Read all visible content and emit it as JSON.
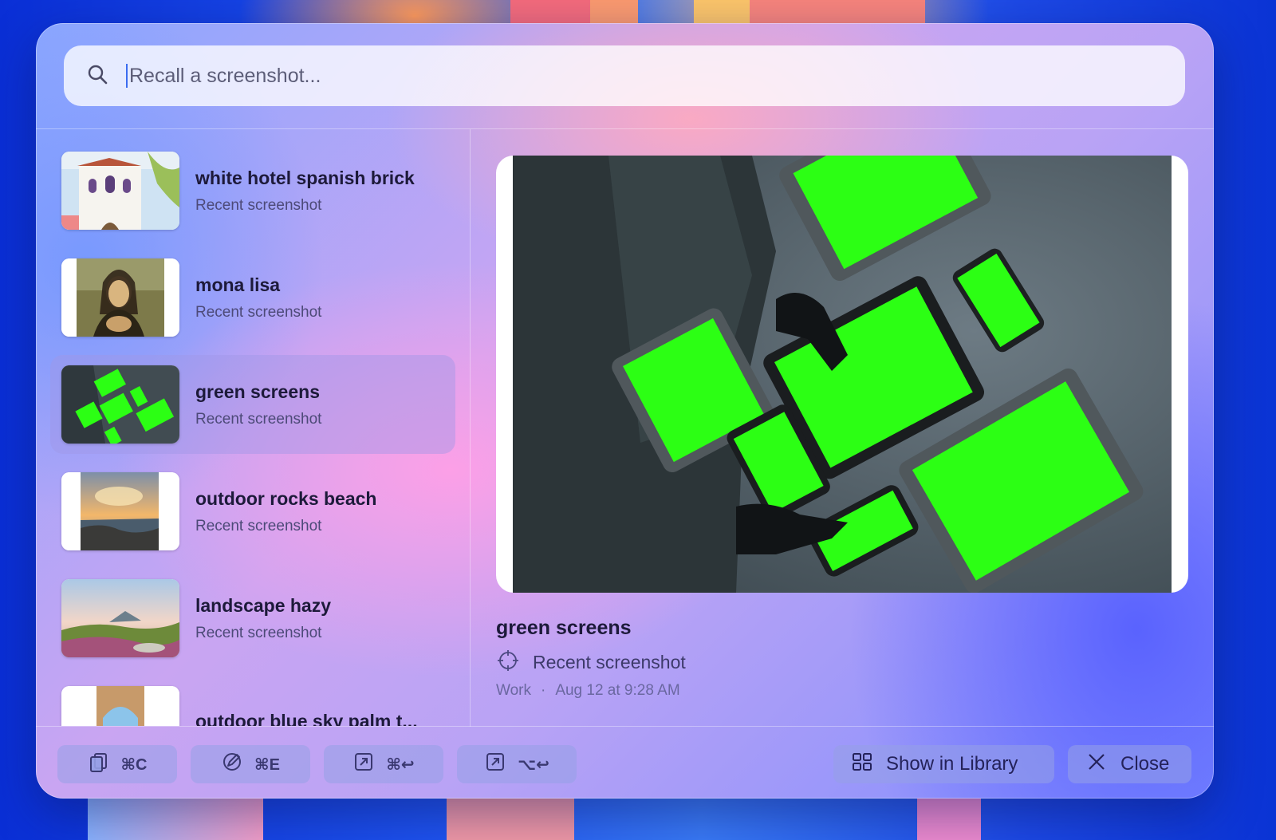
{
  "search": {
    "placeholder": "Recall a screenshot...",
    "icon": "search-icon"
  },
  "list": {
    "items": [
      {
        "title": "white hotel spanish brick",
        "subtitle": "Recent screenshot",
        "selected": false
      },
      {
        "title": "mona lisa",
        "subtitle": "Recent screenshot",
        "selected": false
      },
      {
        "title": "green screens",
        "subtitle": "Recent screenshot",
        "selected": true
      },
      {
        "title": "outdoor rocks beach",
        "subtitle": "Recent screenshot",
        "selected": false
      },
      {
        "title": "landscape hazy",
        "subtitle": "Recent screenshot",
        "selected": false
      },
      {
        "title": "outdoor blue sky palm t...",
        "subtitle": "",
        "selected": false
      }
    ]
  },
  "preview": {
    "title": "green screens",
    "subtitle": "Recent screenshot",
    "category": "Work",
    "separator": "·",
    "date": "Aug 12 at 9:28 AM"
  },
  "footer": {
    "copy_shortcut": "⌘C",
    "edit_shortcut": "⌘E",
    "open_shortcut": "⌘↩",
    "open_alt_shortcut": "⌥↩",
    "show_library_label": "Show in Library",
    "close_label": "Close"
  },
  "colors": {
    "accent": "#3b6cf0",
    "selected_row": "#a096e6",
    "screen_green": "#2cff14"
  }
}
